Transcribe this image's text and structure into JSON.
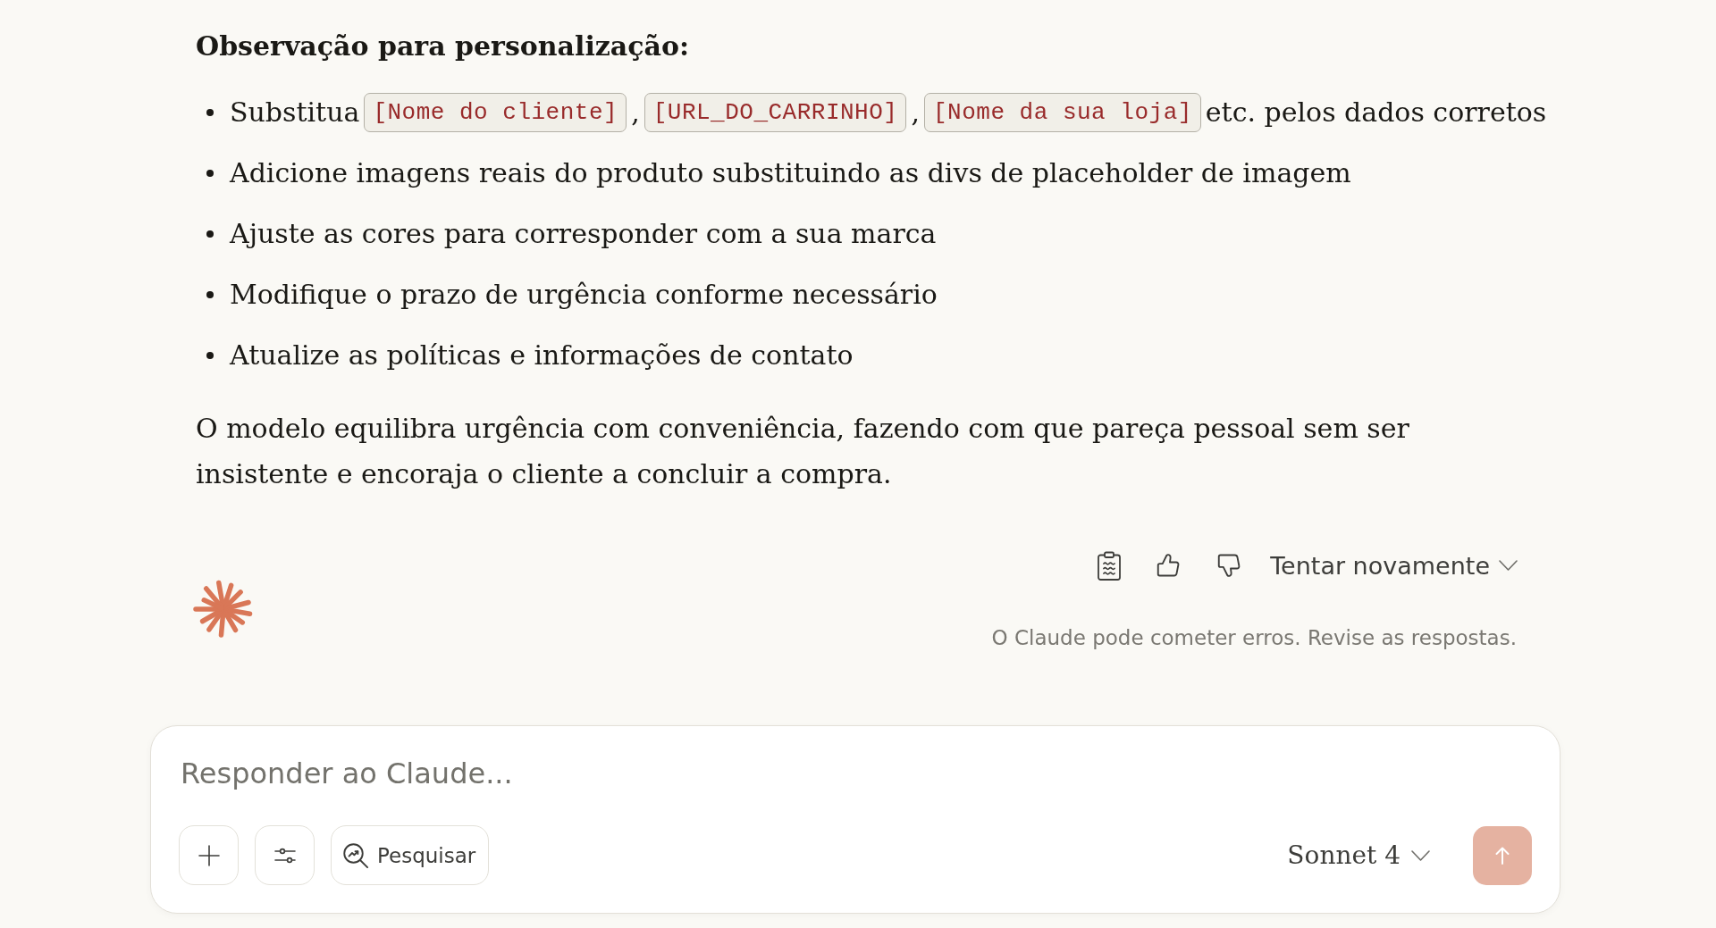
{
  "message": {
    "heading": "Observação para personalização:",
    "bullets": [
      {
        "parts": [
          {
            "kind": "text",
            "text": "Substitua"
          },
          {
            "kind": "code",
            "text": "[Nome do cliente]"
          },
          {
            "kind": "text",
            "text": ","
          },
          {
            "kind": "code",
            "text": "[URL_DO_CARRINHO]"
          },
          {
            "kind": "text",
            "text": ","
          },
          {
            "kind": "code",
            "text": "[Nome da sua loja]"
          },
          {
            "kind": "text",
            "text": "etc. pelos dados corretos"
          }
        ]
      },
      {
        "parts": [
          {
            "kind": "text",
            "text": "Adicione imagens reais do produto substituindo as divs de placeholder de imagem"
          }
        ]
      },
      {
        "parts": [
          {
            "kind": "text",
            "text": "Ajuste as cores para corresponder com a sua marca"
          }
        ]
      },
      {
        "parts": [
          {
            "kind": "text",
            "text": "Modifique o prazo de urgência conforme necessário"
          }
        ]
      },
      {
        "parts": [
          {
            "kind": "text",
            "text": "Atualize as políticas e informações de contato"
          }
        ]
      }
    ],
    "paragraph": "O modelo equilibra urgência com conveniência, fazendo com que pareça pessoal sem ser insistente e encoraja o cliente a concluir a compra."
  },
  "response_actions": {
    "retry_label": "Tentar novamente"
  },
  "disclaimer": "O Claude pode cometer erros. Revise as respostas.",
  "composer": {
    "placeholder": "Responder ao Claude...",
    "search_label": "Pesquisar",
    "model": "Sonnet 4",
    "send_button": {
      "disabled": true
    }
  }
}
